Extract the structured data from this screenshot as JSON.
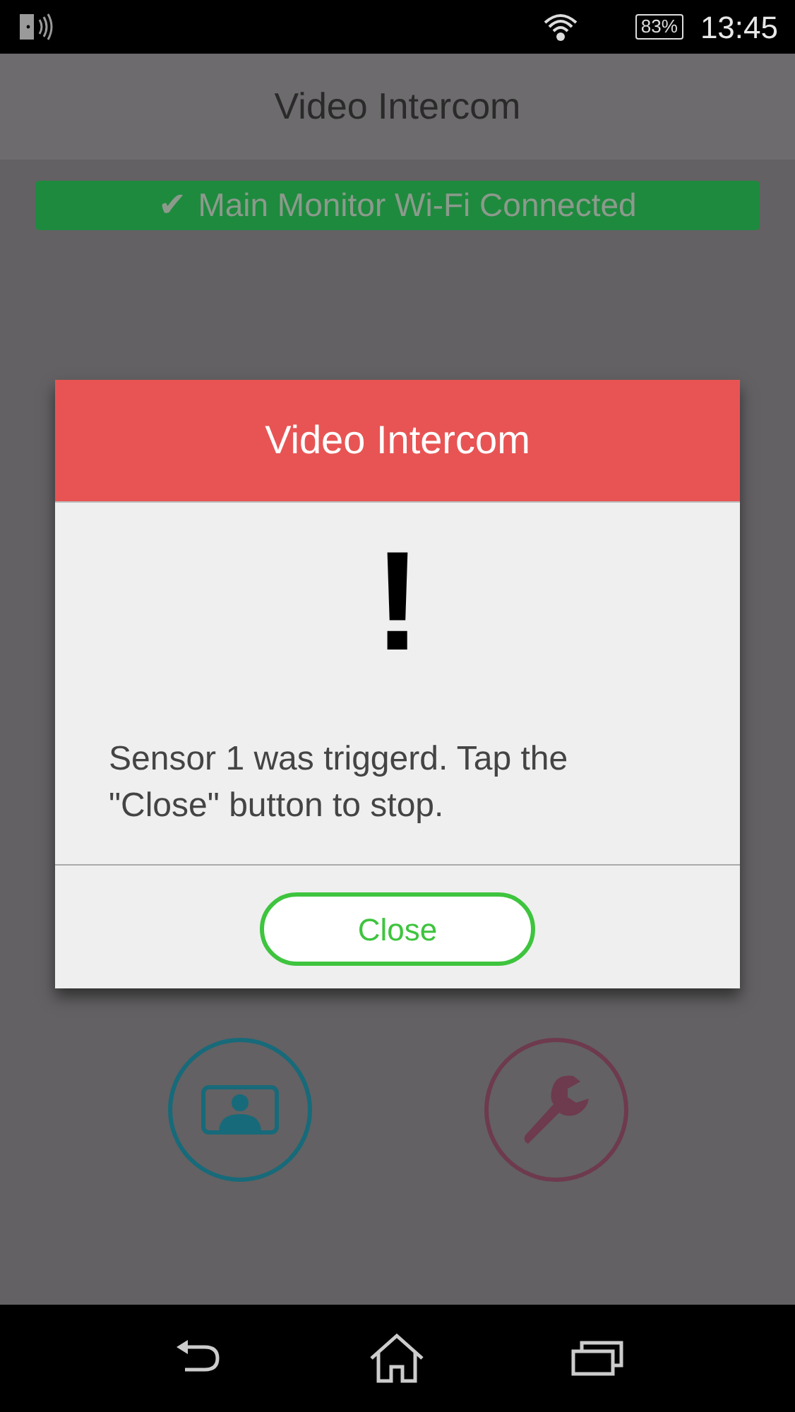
{
  "status_bar": {
    "battery": "83%",
    "time": "13:45"
  },
  "app_bar": {
    "title": "Video Intercom"
  },
  "banner": {
    "check": "✔",
    "text": "Main Monitor Wi-Fi Connected"
  },
  "dialog": {
    "title": "Video Intercom",
    "glyph": "!",
    "message": "Sensor 1 was triggerd. Tap the \"Close\" button to stop.",
    "button": "Close"
  }
}
